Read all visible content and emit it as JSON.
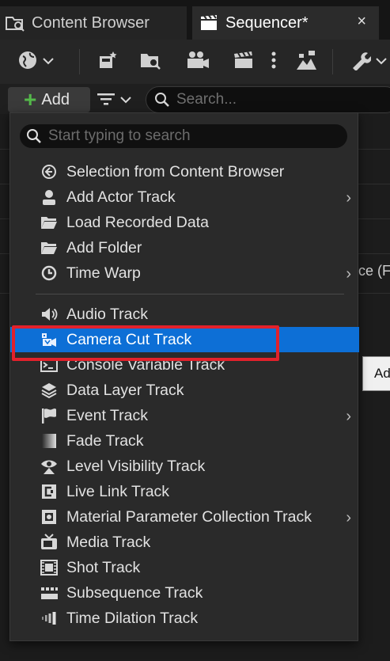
{
  "tabs": [
    {
      "label": "Content Browser",
      "icon": "folder-search-icon"
    },
    {
      "label": "Sequencer*",
      "icon": "clapperboard-icon",
      "close": "×"
    }
  ],
  "toolbar": {
    "buttons": [
      "globe-icon",
      "save-sequence-icon",
      "find-in-browser-icon",
      "render-movie-icon",
      "clapperboard-icon",
      "more-vertical-icon",
      "tree-hierarchy-icon",
      "wrench-icon"
    ]
  },
  "add_row": {
    "add_label": "Add",
    "search_placeholder": "Search..."
  },
  "background": {
    "fragment_text": "ce (Fo",
    "tooltip_text": "Ad"
  },
  "menu": {
    "search_placeholder": "Start typing to search",
    "group1": [
      {
        "label": "Selection from Content Browser",
        "icon": "arrow-circle-icon",
        "submenu": false
      },
      {
        "label": "Add Actor Track",
        "icon": "actor-icon",
        "submenu": true
      },
      {
        "label": "Load Recorded Data",
        "icon": "folder-open-icon",
        "submenu": false
      },
      {
        "label": "Add Folder",
        "icon": "folder-icon",
        "submenu": false
      },
      {
        "label": "Time Warp",
        "icon": "time-warp-icon",
        "submenu": true
      }
    ],
    "group2": [
      {
        "label": "Audio Track",
        "icon": "speaker-icon",
        "submenu": false
      },
      {
        "label": "Camera Cut Track",
        "icon": "camera-cut-icon",
        "submenu": false,
        "selected": true
      },
      {
        "label": "Console Variable Track",
        "icon": "console-icon",
        "submenu": false
      },
      {
        "label": "Data Layer Track",
        "icon": "layers-icon",
        "submenu": false
      },
      {
        "label": "Event Track",
        "icon": "flag-icon",
        "submenu": true
      },
      {
        "label": "Fade Track",
        "icon": "fade-icon",
        "submenu": false
      },
      {
        "label": "Level Visibility Track",
        "icon": "visibility-icon",
        "submenu": false
      },
      {
        "label": "Live Link Track",
        "icon": "live-link-icon",
        "submenu": false
      },
      {
        "label": "Material Parameter Collection Track",
        "icon": "material-icon",
        "submenu": true
      },
      {
        "label": "Media Track",
        "icon": "tv-icon",
        "submenu": false
      },
      {
        "label": "Shot Track",
        "icon": "film-strip-icon",
        "submenu": false
      },
      {
        "label": "Subsequence Track",
        "icon": "subsequence-icon",
        "submenu": false
      },
      {
        "label": "Time Dilation Track",
        "icon": "time-dilation-icon",
        "submenu": false
      }
    ],
    "chevron": "›",
    "highlight_color": "#0d6fd6",
    "annotation_color": "#e3212b"
  }
}
